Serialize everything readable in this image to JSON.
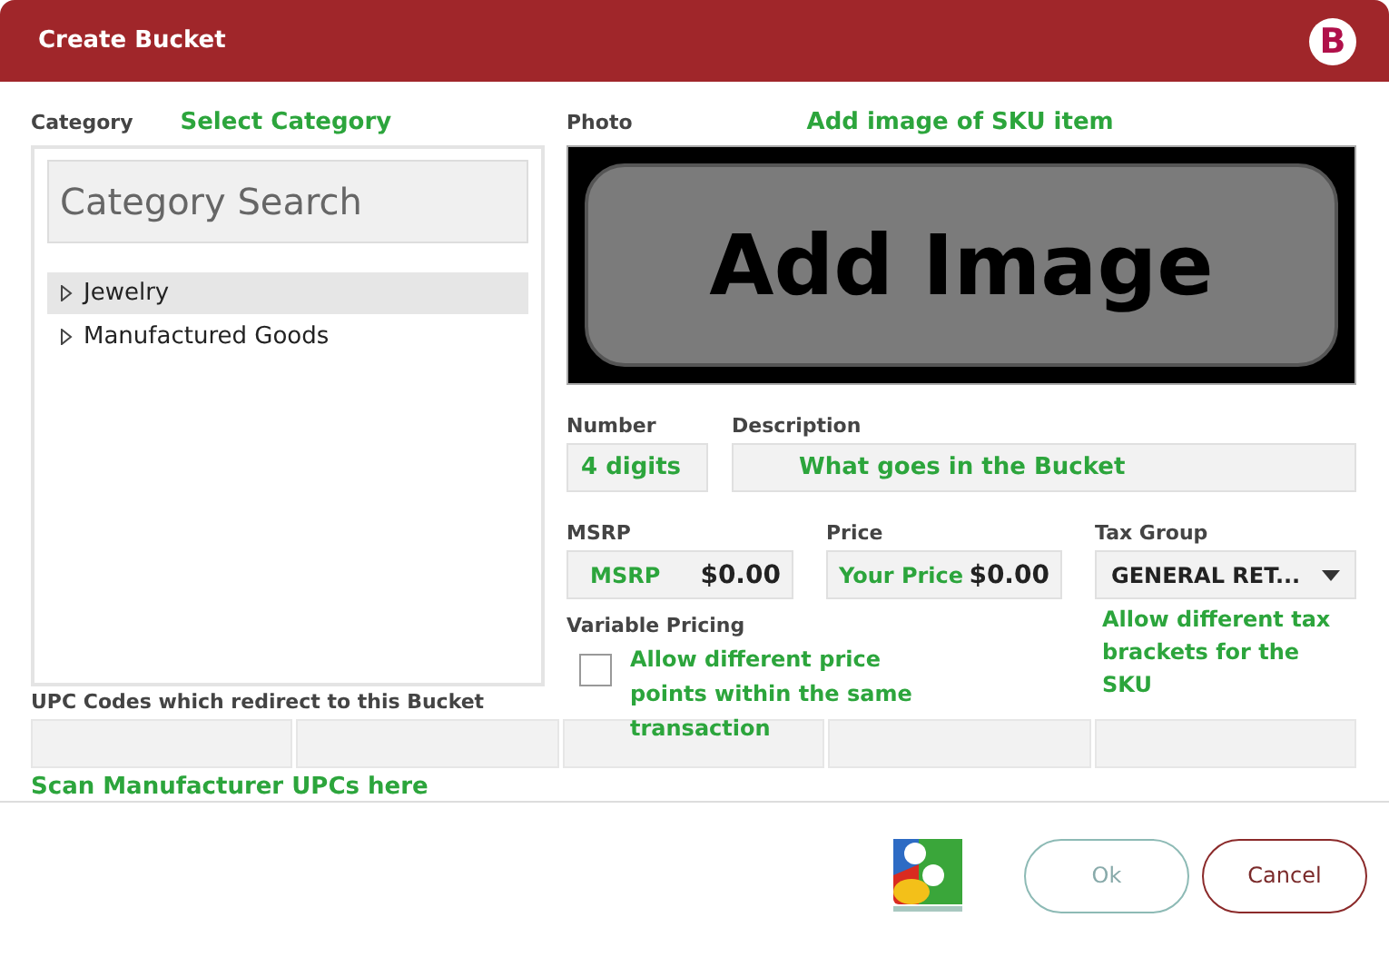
{
  "window": {
    "title": "Create Bucket",
    "logo": "B"
  },
  "category": {
    "label": "Category",
    "note": "Select Category",
    "search": {
      "placeholder": "Category Search"
    },
    "items": [
      {
        "label": "Jewelry",
        "selected": true,
        "expanded": false
      },
      {
        "label": "Manufactured Goods",
        "selected": false,
        "expanded": false
      }
    ]
  },
  "photo": {
    "label": "Photo",
    "note": "Add image of SKU item",
    "button": "Add Image"
  },
  "number": {
    "label": "Number",
    "note": "4 digits"
  },
  "description": {
    "label": "Description",
    "note": "What goes in the Bucket"
  },
  "msrp": {
    "label": "MSRP",
    "note": "MSRP",
    "value": "$0.00"
  },
  "price": {
    "label": "Price",
    "note": "Your Price",
    "value": "$0.00"
  },
  "tax_group": {
    "label": "Tax Group",
    "value": "GENERAL RET...",
    "note": "Allow different tax brackets for the SKU"
  },
  "variable_pricing": {
    "label": "Variable Pricing",
    "checked": false,
    "note": "Allow different price points within the same transaction"
  },
  "upc": {
    "label": "UPC Codes which redirect to this Bucket",
    "note": "Scan Manufacturer UPCs here"
  },
  "buttons": [
    {
      "label": "Ok",
      "kind": "ok"
    },
    {
      "label": "Cancel",
      "kind": "cancel"
    }
  ]
}
